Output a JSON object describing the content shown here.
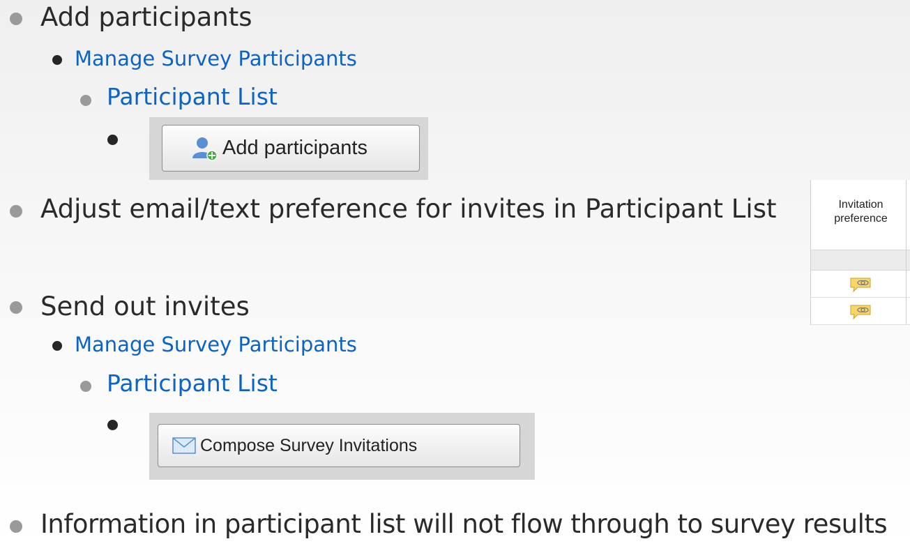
{
  "items": {
    "add_participants": "Add participants",
    "manage_1": "Manage Survey Participants",
    "plist_1": "Participant List",
    "adjust": "Adjust email/text preference for invites in Participant List",
    "send": "Send out invites",
    "manage_2": "Manage Survey Participants",
    "plist_2": "Participant List",
    "info": "Information in participant list will not flow through to survey results"
  },
  "buttons": {
    "add_participants": "Add participants",
    "compose_invitations": "Compose Survey Invitations"
  },
  "invitation_column": {
    "header_line1": "Invitation",
    "header_line2": "preference",
    "rows": [
      "sms-chat-icon",
      "sms-chat-icon"
    ]
  },
  "colors": {
    "link_blue": "#0b63c4",
    "text_dark": "#2a2a2a",
    "bullet_grey": "#9a9a9a"
  }
}
